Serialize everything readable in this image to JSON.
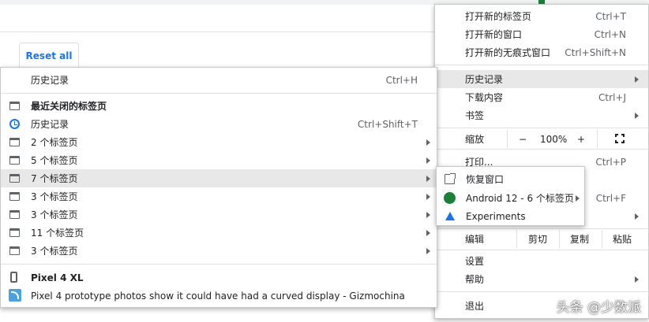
{
  "background": {
    "reset_label": "Reset all"
  },
  "main_menu": {
    "items": [
      {
        "label": "打开新的标签页",
        "shortcut": "Ctrl+T"
      },
      {
        "label": "打开新的窗口",
        "shortcut": "Ctrl+N"
      },
      {
        "label": "打开新的无痕式窗口",
        "shortcut": "Ctrl+Shift+N"
      },
      {
        "label": "历史记录"
      },
      {
        "label": "下载内容",
        "shortcut": "Ctrl+J"
      },
      {
        "label": "书签"
      },
      {
        "label": "打印...",
        "shortcut": "Ctrl+P"
      },
      {
        "label": "",
        "shortcut": "Ctrl+F"
      },
      {
        "label": ""
      },
      {
        "label": "设置"
      },
      {
        "label": "帮助"
      },
      {
        "label": "退出"
      }
    ],
    "zoom": {
      "label": "缩放",
      "minus": "−",
      "value": "100%",
      "plus": "+"
    },
    "edit": {
      "label": "编辑",
      "cut": "剪切",
      "copy": "复制",
      "paste": "粘贴"
    }
  },
  "history_menu": {
    "header": {
      "label": "历史记录",
      "shortcut": "Ctrl+H"
    },
    "recent_title": "最近关闭的标签页",
    "items": [
      {
        "label": "历史记录",
        "shortcut": "Ctrl+Shift+T",
        "icon": "clock-icon"
      },
      {
        "label": "2 个标签页",
        "icon": "tab-icon"
      },
      {
        "label": "5 个标签页",
        "icon": "tab-icon"
      },
      {
        "label": "7 个标签页",
        "icon": "tab-icon"
      },
      {
        "label": "3 个标签页",
        "icon": "tab-icon"
      },
      {
        "label": "3 个标签页",
        "icon": "tab-icon"
      },
      {
        "label": "11 个标签页",
        "icon": "tab-icon"
      },
      {
        "label": "3 个标签页",
        "icon": "tab-icon"
      }
    ],
    "device": {
      "name": "Pixel 4 XL",
      "page": "Pixel 4 prototype photos show it could have had a curved display - Gizmochina"
    }
  },
  "window_menu": {
    "items": [
      {
        "label": "恢复窗口",
        "icon": "restore-icon"
      },
      {
        "label": "Android 12 - 6 个标签页",
        "icon": "dot-icon",
        "color": "#188038"
      },
      {
        "label": "Experiments",
        "icon": "flask-icon",
        "color": "#1a73e8"
      }
    ]
  },
  "watermark": "头条 @少数派"
}
